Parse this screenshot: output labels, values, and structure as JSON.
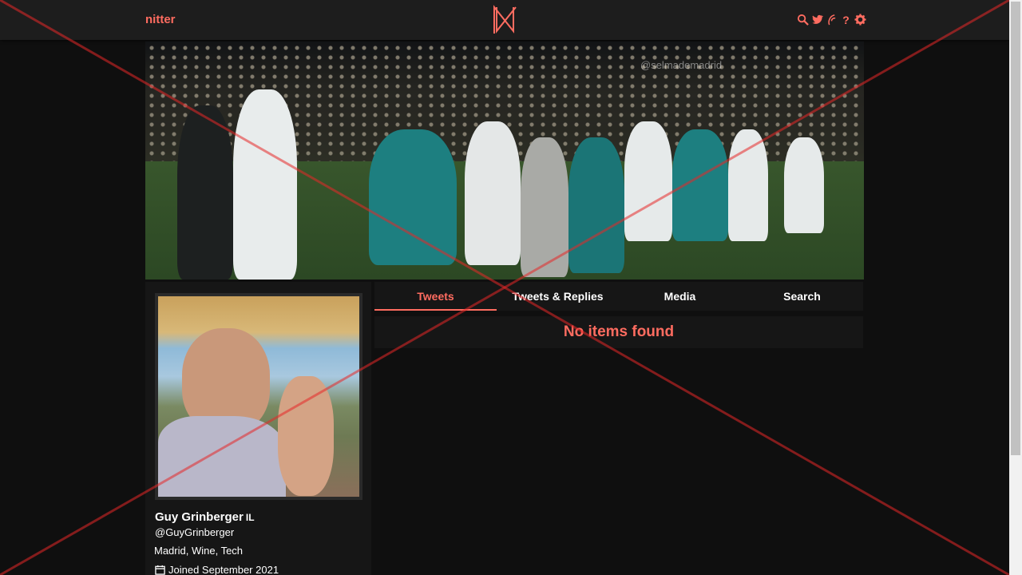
{
  "navbar": {
    "brand": "nitter",
    "icons": [
      "search-icon",
      "bird-icon",
      "rss-icon",
      "help-icon",
      "gear-icon"
    ]
  },
  "banner": {
    "watermark": "@selmademadrid"
  },
  "tabs": [
    {
      "label": "Tweets",
      "active": true
    },
    {
      "label": "Tweets & Replies",
      "active": false
    },
    {
      "label": "Media",
      "active": false
    },
    {
      "label": "Search",
      "active": false
    }
  ],
  "timeline": {
    "empty_message": "No items found"
  },
  "profile": {
    "name": "Guy Grinberger",
    "flag": "IL",
    "handle": "@GuyGrinberger",
    "bio": "Madrid, Wine, Tech",
    "joined": "Joined September 2021"
  },
  "colors": {
    "accent": "#ff6c60",
    "background": "#0f0f0f",
    "panel": "#161616",
    "navbar": "#1d1d1d"
  }
}
